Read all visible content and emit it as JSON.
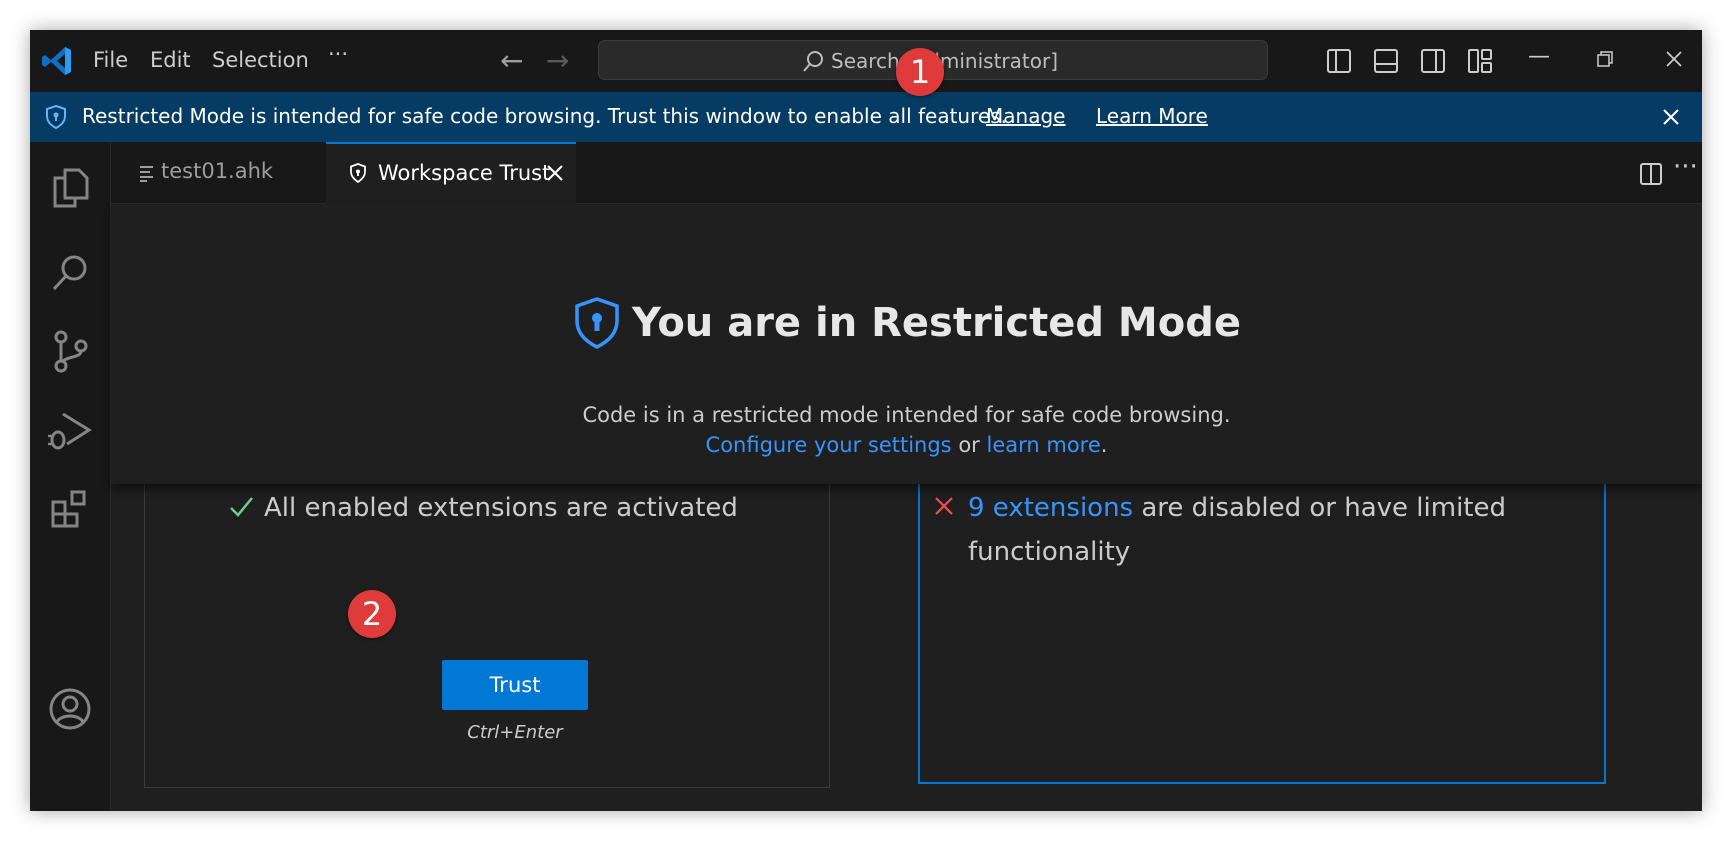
{
  "menu": [
    "File",
    "Edit",
    "Selection",
    "···"
  ],
  "search": {
    "label": "Search [Administrator]"
  },
  "banner": {
    "message": "Restricted Mode is intended for safe code browsing. Trust this window to enable all features.",
    "manage": "Manage",
    "learn_more": "Learn More"
  },
  "tabs": [
    {
      "label": "test01.ahk",
      "icon": "lines-icon"
    },
    {
      "label": "Workspace Trust",
      "icon": "shield-icon"
    }
  ],
  "trust_page": {
    "title": "You are in Restricted Mode",
    "desc_line1": "Code is in a restricted mode intended for safe code browsing.",
    "configure_link": "Configure your settings",
    "or_text": "or",
    "learn_link": "learn more",
    "period": "."
  },
  "trusted_card": {
    "feature": "All enabled extensions are activated",
    "button": "Trust",
    "shortcut": "Ctrl+Enter"
  },
  "restricted_card": {
    "feature_link": "9 extensions",
    "feature_text_1": "are disabled or have limited",
    "feature_text_2": "functionality"
  },
  "annotations": [
    "1",
    "2"
  ],
  "colors": {
    "accent": "#0078d4",
    "banner": "#063b63",
    "badge": "#e03b3b"
  }
}
